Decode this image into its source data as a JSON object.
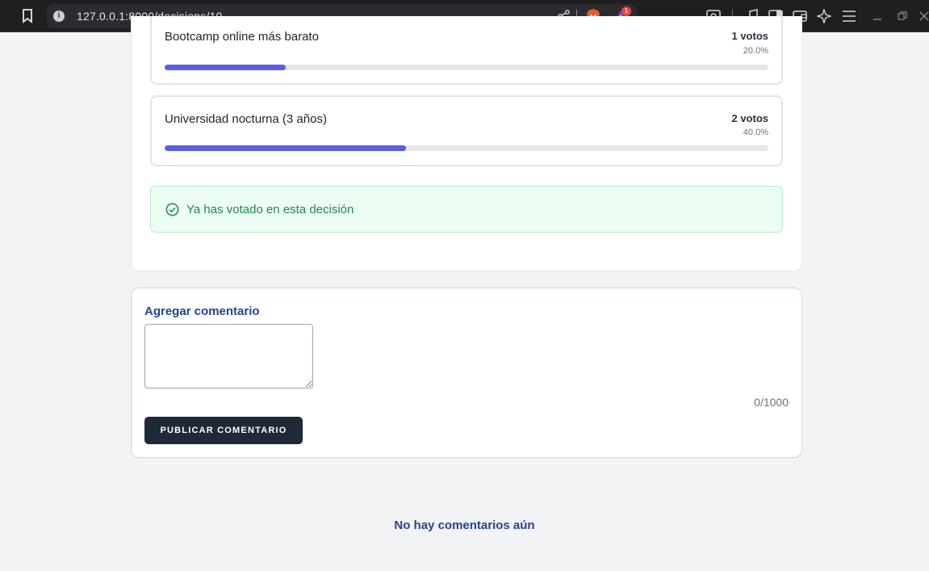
{
  "browser": {
    "url": "127.0.0.1:8000/decisions/10",
    "bat_badge": "1"
  },
  "options": [
    {
      "label": "Bootcamp online más barato",
      "votes": "1 votos",
      "percent_text": "20.0%",
      "percent": 20.0
    },
    {
      "label": "Universidad nocturna (3 años)",
      "votes": "2 votos",
      "percent_text": "40.0%",
      "percent": 40.0
    }
  ],
  "voted_notice": {
    "message": "Ya has votado en esta decisión"
  },
  "comment_form": {
    "title": "Agregar comentario",
    "textarea_value": "",
    "char_count": "0/1000",
    "submit_label": "PUBLICAR COMENTARIO"
  },
  "comments": {
    "empty_message": "No hay comentarios aún"
  },
  "colors": {
    "accent_bar": "#5b5fe0",
    "success_text": "#1f8a4c",
    "heading_blue": "#27428f",
    "button_dark": "#1f2937"
  }
}
